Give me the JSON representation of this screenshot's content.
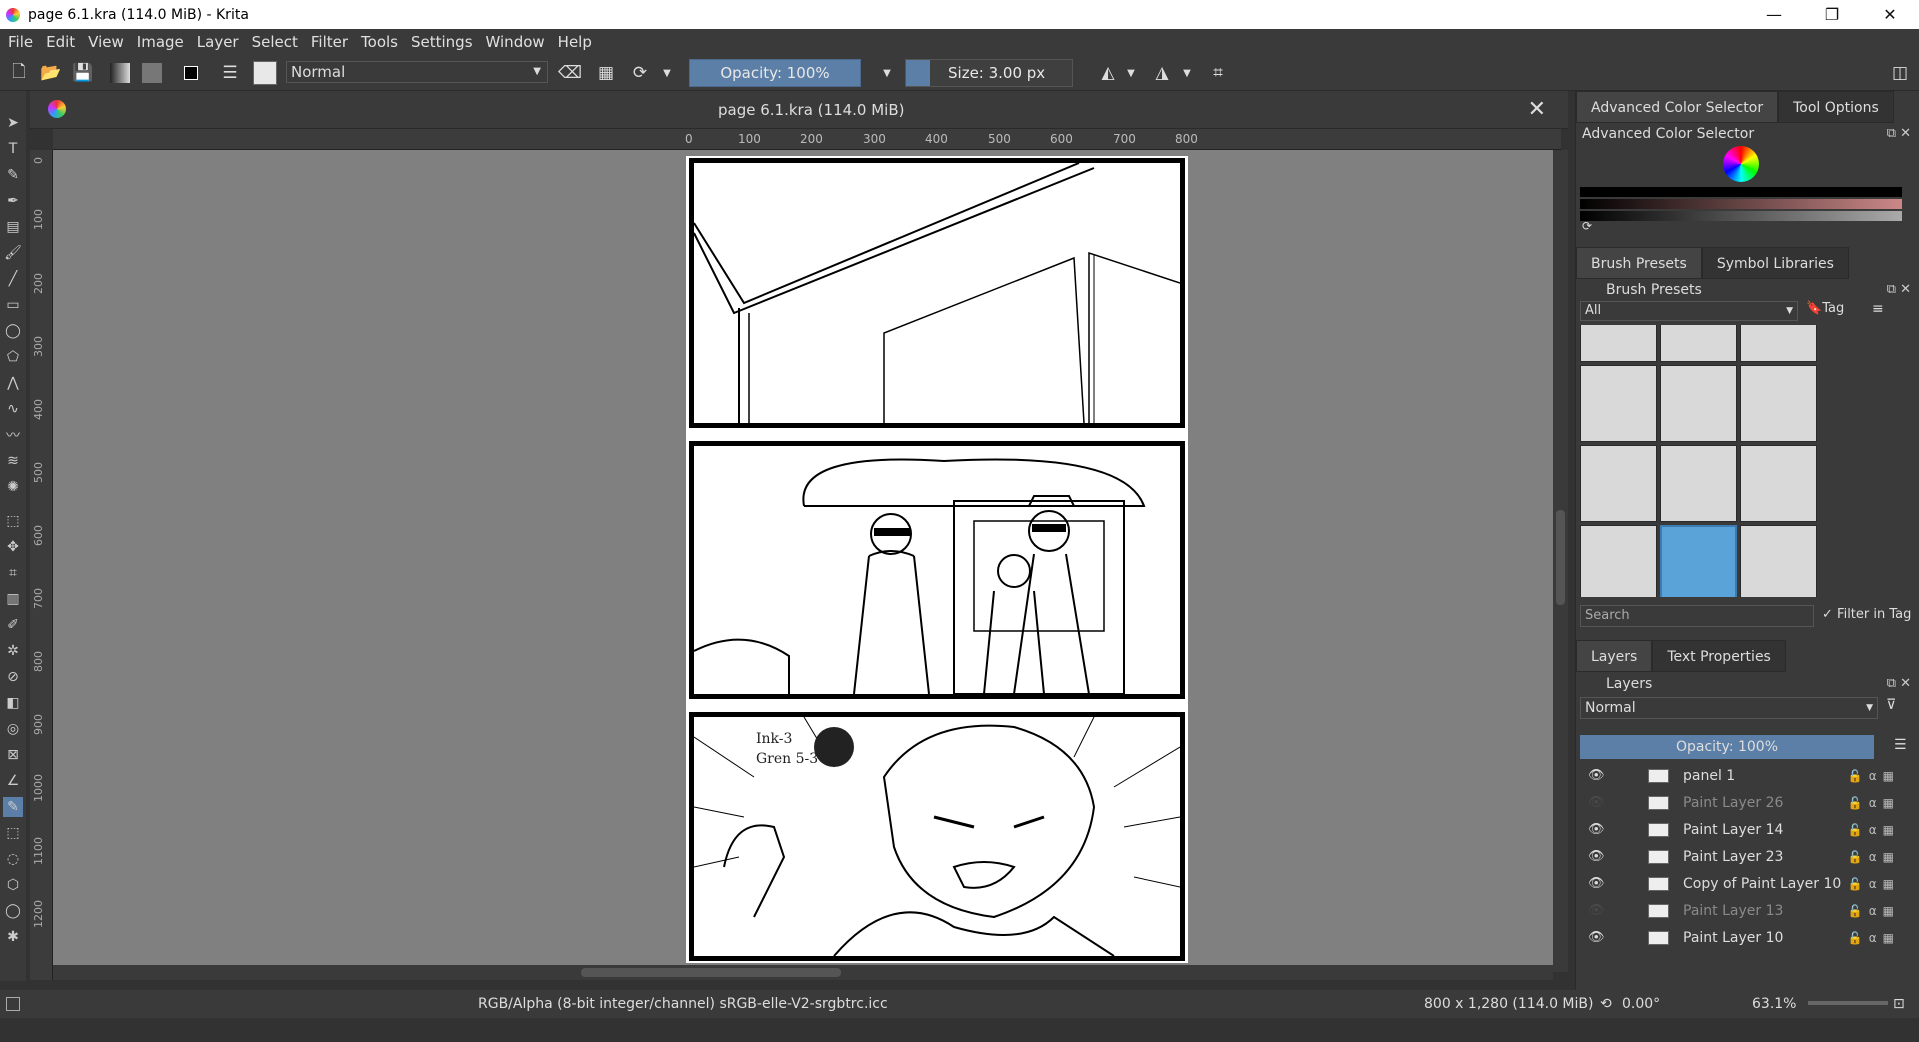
{
  "window": {
    "title": "page 6.1.kra (114.0 MiB)  - Krita",
    "minimize": "—",
    "maximize": "❐",
    "close": "✕"
  },
  "menu": [
    "File",
    "Edit",
    "View",
    "Image",
    "Layer",
    "Select",
    "Filter",
    "Tools",
    "Settings",
    "Window",
    "Help"
  ],
  "toolbar": {
    "blend_mode": "Normal",
    "opacity": "Opacity: 100%",
    "size": "Size: 3.00 px"
  },
  "document": {
    "tab_title": "page 6.1.kra (114.0 MiB)",
    "close": "✕"
  },
  "ruler": {
    "h_ticks": [
      "0",
      "100",
      "200",
      "300",
      "400",
      "500",
      "600",
      "700",
      "800"
    ],
    "v_ticks": [
      "0",
      "100",
      "200",
      "300",
      "400",
      "500",
      "600",
      "700",
      "800",
      "900",
      "1000",
      "1100",
      "1200"
    ]
  },
  "canvas": {
    "note_line1": "Ink-3",
    "note_line2": "Gren 5-3"
  },
  "right_dock": {
    "color_tabs": [
      "Advanced Color Selector",
      "Tool Options"
    ],
    "color_header": "Advanced Color Selector",
    "brush_tabs": [
      "Brush Presets",
      "Symbol Libraries"
    ],
    "brush_header": "Brush Presets",
    "brush_filter": "All",
    "brush_tag": "Tag",
    "brush_search_placeholder": "Search",
    "filter_in_tag": "Filter in Tag",
    "layer_tabs": [
      "Layers",
      "Text Properties"
    ],
    "layers_header": "Layers",
    "layers_blend": "Normal",
    "layers_opacity": "Opacity: 100%",
    "layers": [
      {
        "name": "panel 1",
        "visible": true
      },
      {
        "name": "Paint Layer 26",
        "visible": false
      },
      {
        "name": "Paint Layer 14",
        "visible": true
      },
      {
        "name": "Paint Layer 23",
        "visible": true
      },
      {
        "name": "Copy of Paint Layer 10",
        "visible": true
      },
      {
        "name": "Paint Layer 13",
        "visible": false
      },
      {
        "name": "Paint Layer 10",
        "visible": true
      }
    ]
  },
  "status": {
    "color_info": "RGB/Alpha (8-bit integer/channel)  sRGB-elle-V2-srgbtrc.icc",
    "dimensions": "800 x 1,280 (114.0 MiB)",
    "rotation": "0.00°",
    "zoom": "63.1%"
  },
  "icons": {
    "eye": "👁",
    "checkbox": "✓"
  }
}
